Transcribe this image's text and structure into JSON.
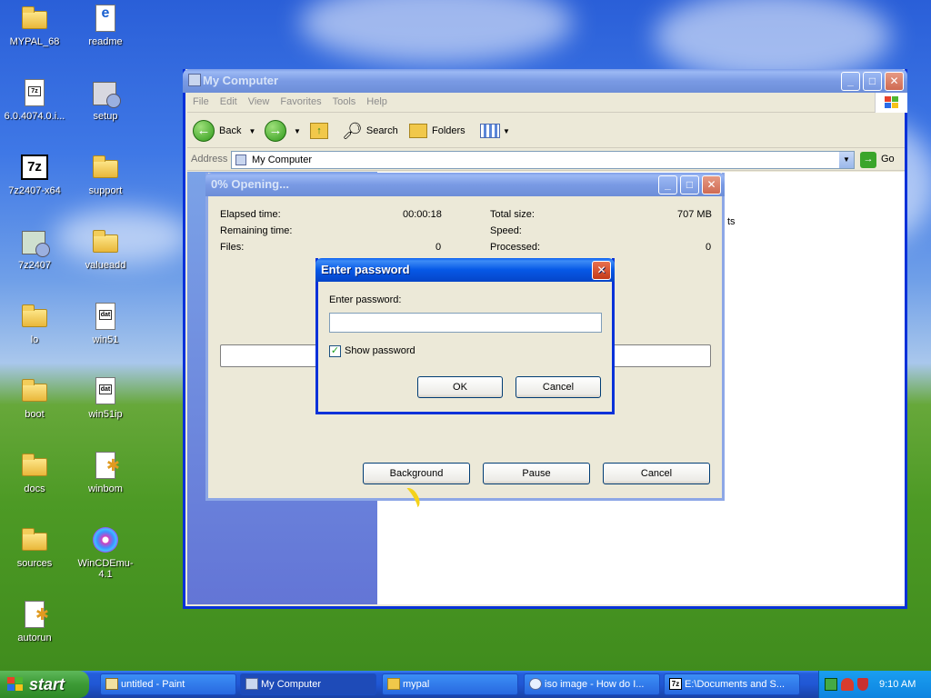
{
  "desktop_icons": [
    {
      "label": "MYPAL_68",
      "icon": "folder-icon"
    },
    {
      "label": "readme",
      "icon": "ie-document-icon"
    },
    {
      "label": "6.0.4074.0.i...",
      "icon": "7z-archive-icon"
    },
    {
      "label": "setup",
      "icon": "setup-icon"
    },
    {
      "label": "7z2407-x64",
      "icon": "7z-app-icon"
    },
    {
      "label": "support",
      "icon": "folder-icon"
    },
    {
      "label": "7z2407",
      "icon": "installer-icon"
    },
    {
      "label": "valueadd",
      "icon": "folder-icon"
    },
    {
      "label": "lo",
      "icon": "folder-icon"
    },
    {
      "label": "win51",
      "icon": "dat-file-icon"
    },
    {
      "label": "boot",
      "icon": "folder-icon"
    },
    {
      "label": "win51ip",
      "icon": "dat-file-icon"
    },
    {
      "label": "docs",
      "icon": "folder-icon"
    },
    {
      "label": "winbom",
      "icon": "config-file-icon"
    },
    {
      "label": "sources",
      "icon": "folder-icon"
    },
    {
      "label": "WinCDEmu-4.1",
      "icon": "cd-emulator-icon"
    },
    {
      "label": "autorun",
      "icon": "config-file-icon"
    }
  ],
  "explorer": {
    "title": "My Computer",
    "menu": [
      "File",
      "Edit",
      "View",
      "Favorites",
      "Tools",
      "Help"
    ],
    "toolbar": {
      "back": "Back",
      "search": "Search",
      "folders": "Folders"
    },
    "address_label": "Address",
    "address_value": "My Computer",
    "go_label": "Go",
    "partial_text": "ts"
  },
  "progress": {
    "title": "0% Opening...",
    "elapsed_label": "Elapsed time:",
    "elapsed_value": "00:00:18",
    "remaining_label": "Remaining time:",
    "files_label": "Files:",
    "files_value": "0",
    "total_size_label": "Total size:",
    "total_size_value": "707 MB",
    "speed_label": "Speed:",
    "processed_label": "Processed:",
    "processed_value": "0",
    "percent": 0,
    "buttons": {
      "background": "Background",
      "pause": "Pause",
      "cancel": "Cancel"
    }
  },
  "password_dialog": {
    "title": "Enter password",
    "prompt": "Enter password:",
    "value": "",
    "show_password_label": "Show password",
    "show_password_checked": true,
    "ok": "OK",
    "cancel": "Cancel"
  },
  "taskbar": {
    "start": "start",
    "tasks": [
      {
        "label": "untitled - Paint",
        "icon": "paint-icon"
      },
      {
        "label": "My Computer",
        "icon": "computer-icon"
      },
      {
        "label": "mypal",
        "icon": "folder-icon"
      },
      {
        "label": "iso image - How do I...",
        "icon": "browser-icon"
      },
      {
        "label": "E:\\Documents and S...",
        "icon": "7z-app-icon"
      }
    ],
    "clock": "9:10 AM"
  },
  "colors": {
    "xp_blue": "#0a5ff0",
    "start_green": "#3c9a35",
    "tray_blue": "#0e84e0",
    "dialog_face": "#ece9d8"
  }
}
